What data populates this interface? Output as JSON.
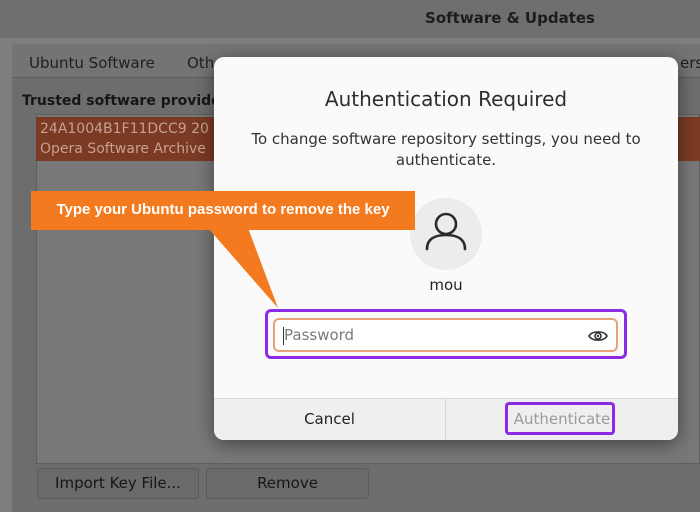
{
  "window": {
    "title": "Software & Updates",
    "tabs": [
      {
        "label": "Ubuntu Software"
      },
      {
        "label": "Oth"
      },
      {
        "label": "ers"
      }
    ],
    "section_label": "Trusted software provide",
    "keys": [
      {
        "line": "24A1004B1F11DCC9 20"
      },
      {
        "line": "Opera Software Archive"
      }
    ],
    "buttons": {
      "import": "Import Key File...",
      "remove": "Remove"
    }
  },
  "dialog": {
    "title": "Authentication Required",
    "message": "To change software repository settings, you need to authenticate.",
    "avatar_icon": "user-icon",
    "username": "mou",
    "password": {
      "placeholder": "Password",
      "value": "",
      "icon": "eye-icon"
    },
    "cancel_label": "Cancel",
    "authenticate_label": "Authenticate"
  },
  "callout": {
    "text": "Type your Ubuntu password to remove the key",
    "color": "#f47a1f"
  },
  "colors": {
    "highlight": "#8b2be2",
    "selection": "#7a3a24",
    "field_focus": "#e8a277"
  }
}
